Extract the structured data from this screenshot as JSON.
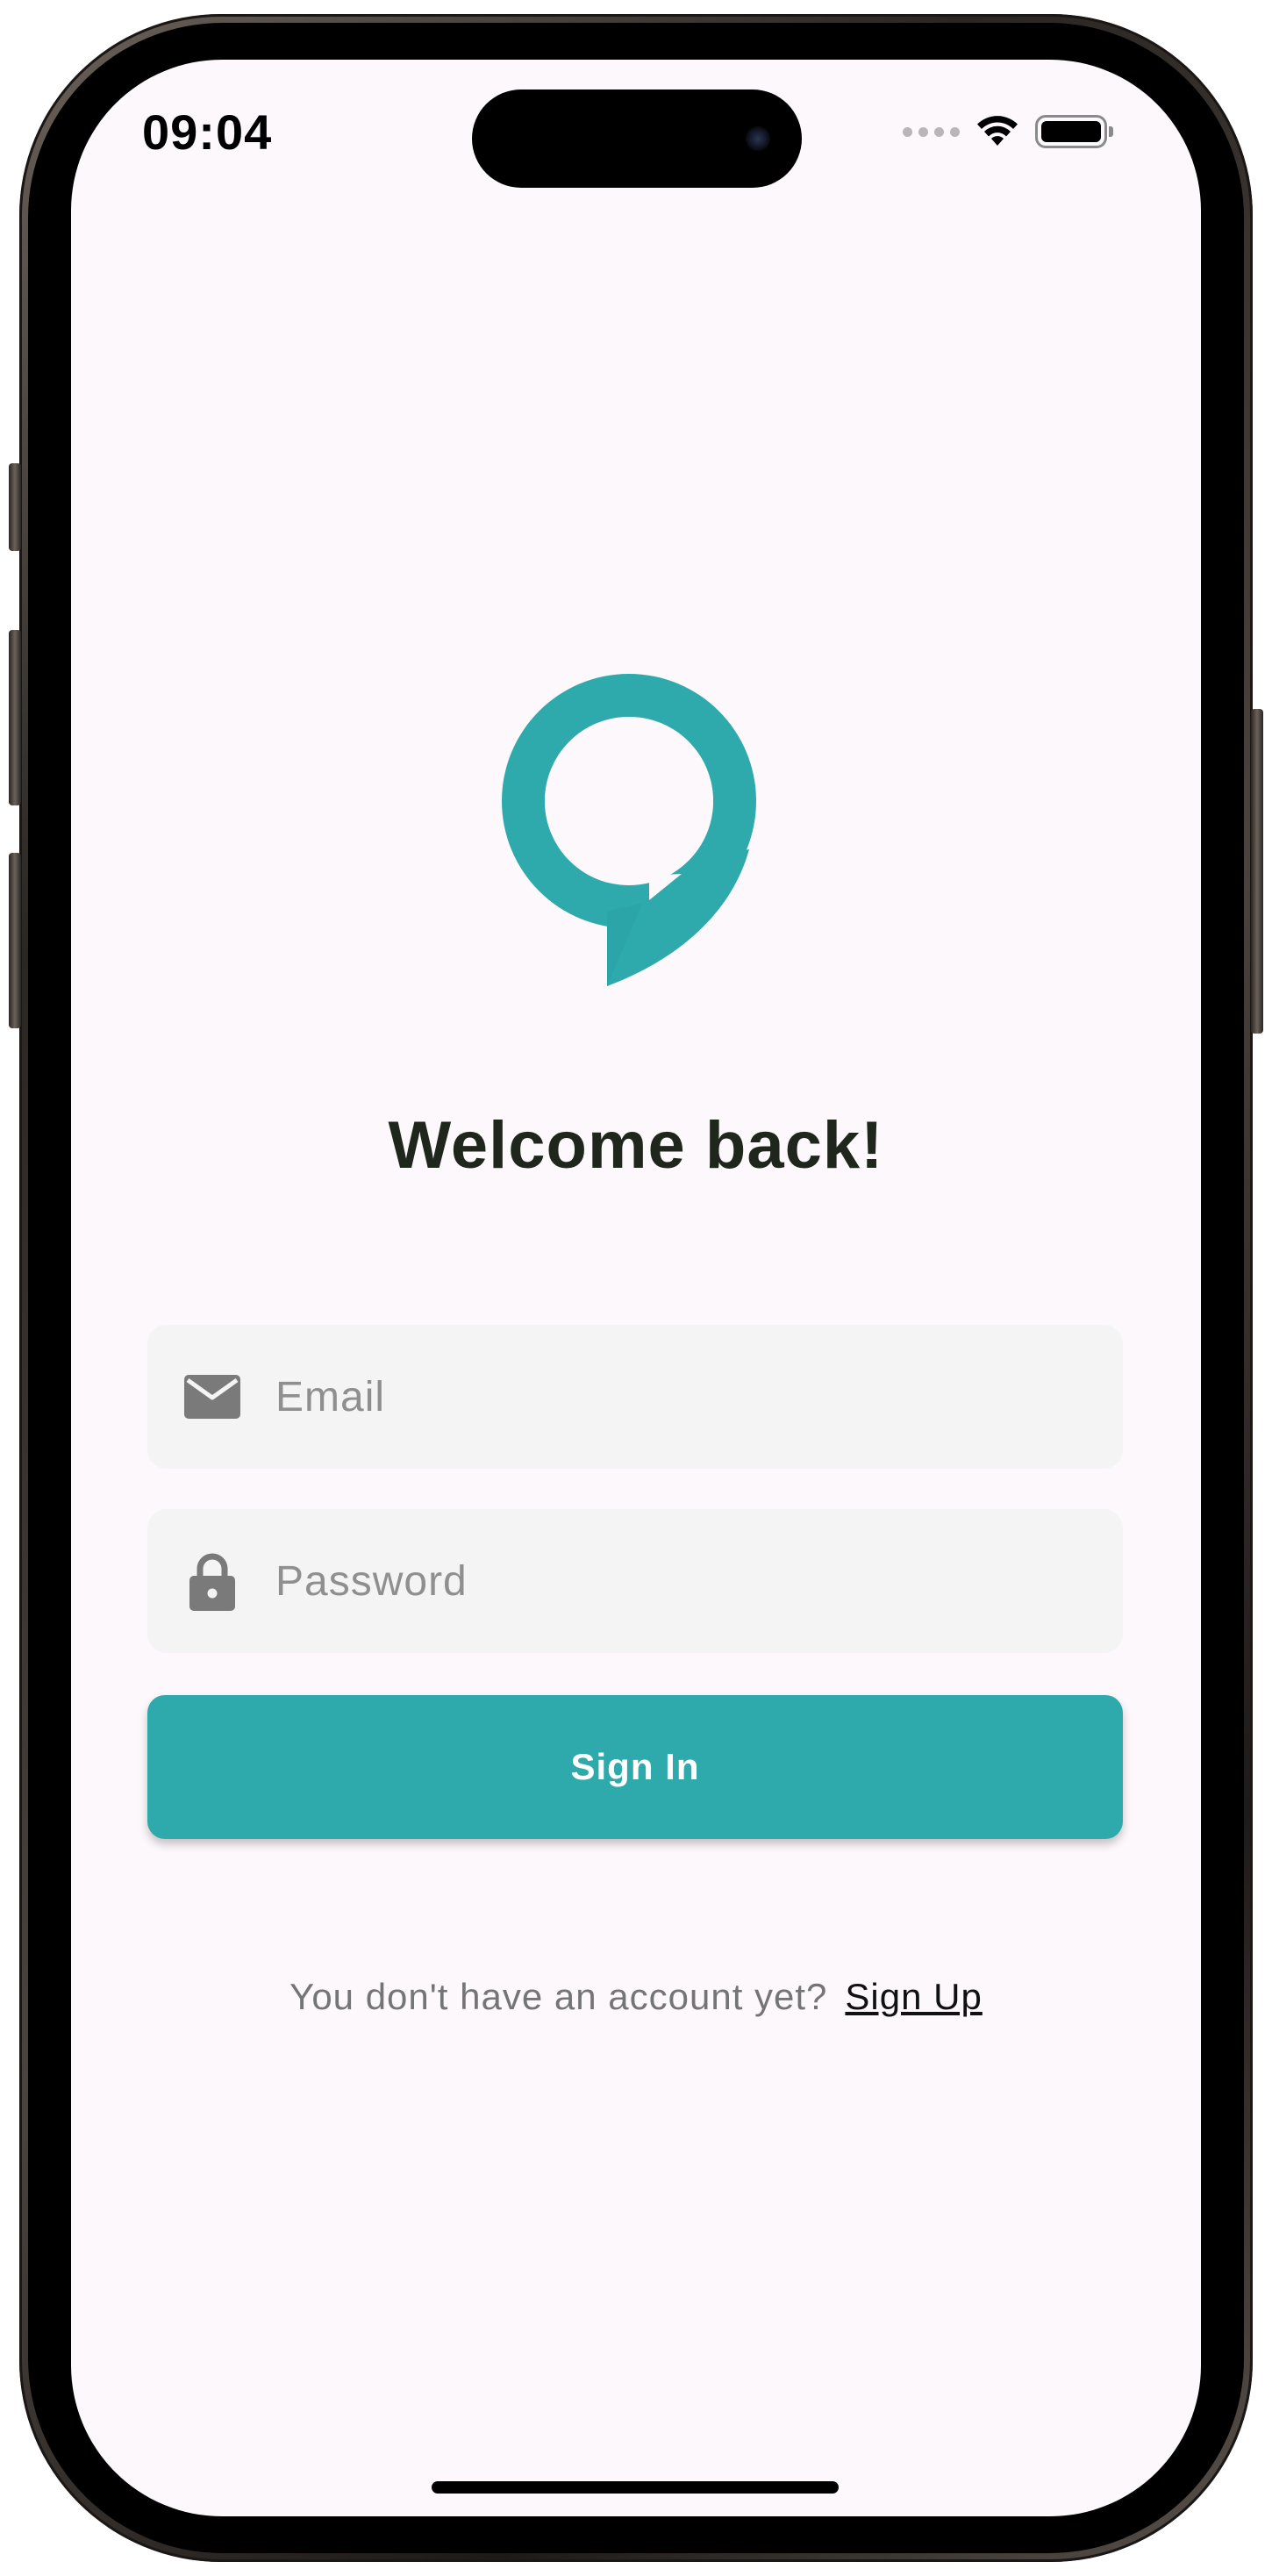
{
  "status_bar": {
    "time": "09:04"
  },
  "icons": {
    "logo": "chat-bubble-logo",
    "email": "envelope-icon",
    "password": "lock-icon",
    "wifi": "wifi-icon",
    "battery": "battery-icon",
    "signal": "cellular-signal-icon"
  },
  "login": {
    "title": "Welcome back!",
    "email_placeholder": "Email",
    "email_value": "",
    "password_placeholder": "Password",
    "password_value": "",
    "sign_in_label": "Sign In",
    "signup_prompt": "You don't have an account yet?",
    "signup_link": "Sign Up"
  },
  "colors": {
    "accent": "#2eaaad",
    "background": "#fdf8fb",
    "field_background": "#f4f4f4",
    "title_text": "#1f271d",
    "icon_gray": "#7a7a7a"
  }
}
